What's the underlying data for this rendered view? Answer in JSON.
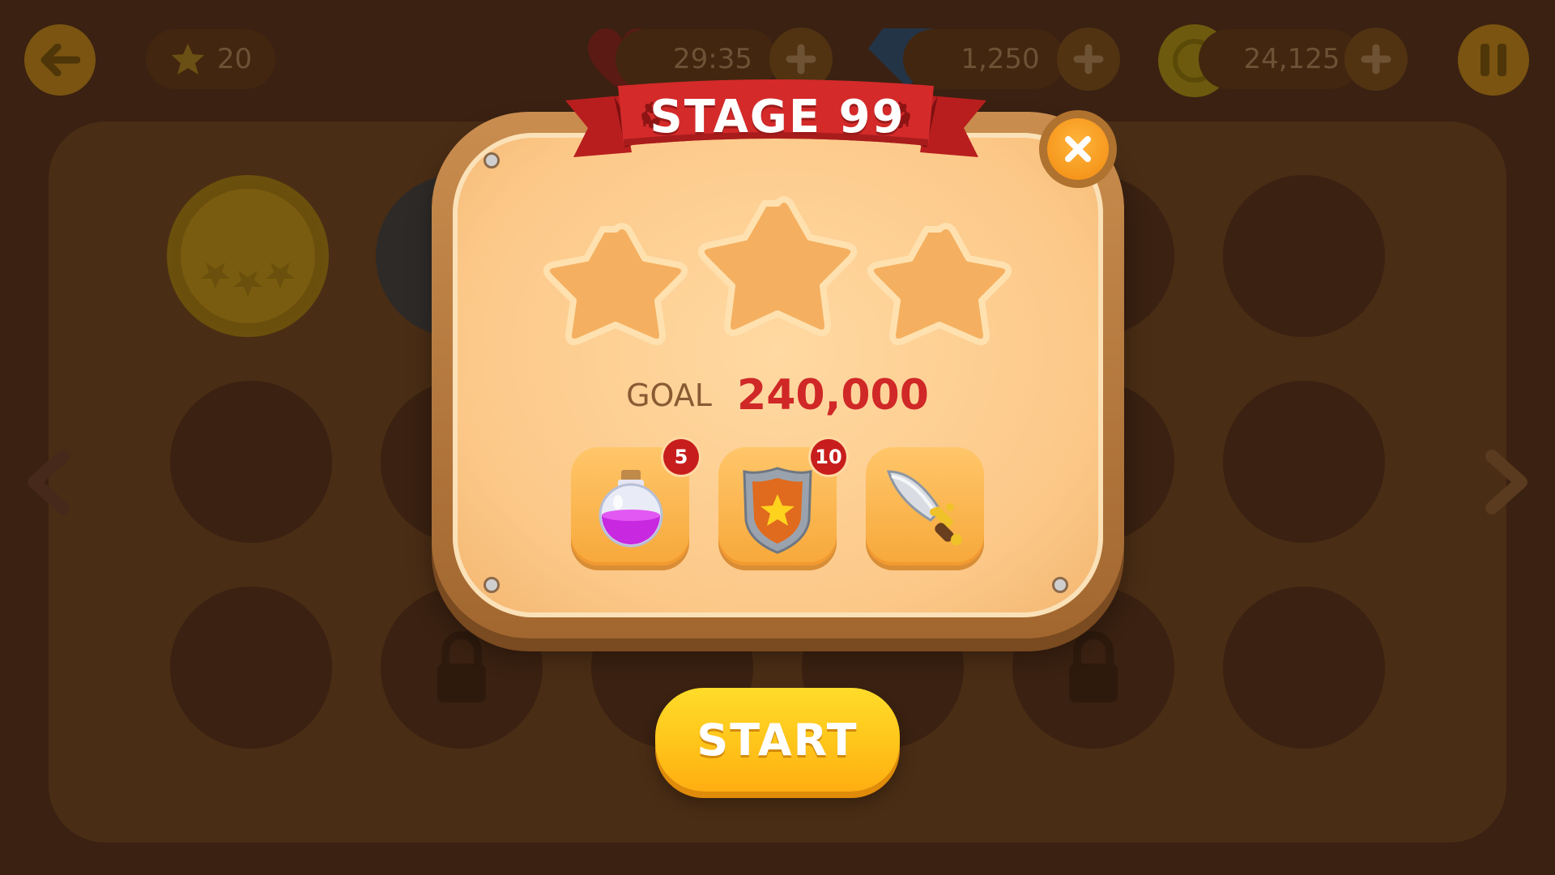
{
  "hud": {
    "stars_count": "20",
    "lives_timer": "29:35",
    "gems_count": "1,250",
    "coins_count": "24,125"
  },
  "dialog": {
    "title": "STAGE 99",
    "goal_label": "GOAL",
    "goal_value": "240,000",
    "earned_stars": 0,
    "max_stars": 3,
    "boosters": [
      {
        "name": "potion",
        "count": "5"
      },
      {
        "name": "shield",
        "count": "10"
      },
      {
        "name": "sword",
        "count": ""
      }
    ],
    "start_label": "START"
  },
  "colors": {
    "banner_red": "#d42a2a",
    "start_yellow": "#ffc41a",
    "goal_red": "#d02727",
    "panel_tan": "#fcc888"
  }
}
